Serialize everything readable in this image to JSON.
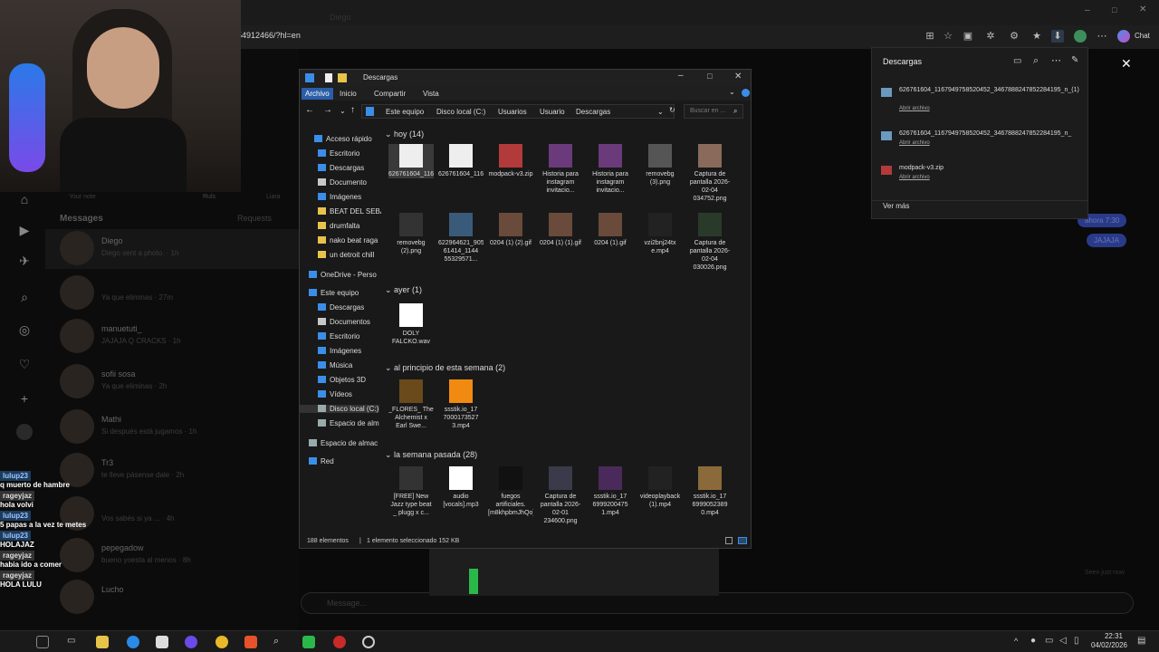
{
  "browser": {
    "url": "54912466/?hl=en",
    "chat_label": "Chat"
  },
  "instagram": {
    "nav_icons": [
      "home-icon",
      "search-icon",
      "explore-icon",
      "reels-icon",
      "messages-icon",
      "notifications-icon",
      "create-icon",
      "profile-icon"
    ],
    "top_labels": [
      "Your note",
      "Ruls",
      "Liara"
    ],
    "messages_label": "Messages",
    "requests_label": "Requests",
    "conversations": [
      {
        "name": "Diego",
        "preview": "Diego sent a photo. · 1h"
      },
      {
        "name": "",
        "preview": "Ya que eliminas · 27m"
      },
      {
        "name": "manuetuti_",
        "preview": "JAJAJA Q CRACKS · 1h"
      },
      {
        "name": "sofii sosa",
        "preview": "Ya que eliminas · 2h"
      },
      {
        "name": "Mathi",
        "preview": "Si después está jugamos · 1h"
      },
      {
        "name": "Tr3",
        "preview": "te lleve pásense dale · 2h"
      },
      {
        "name": "",
        "preview": "Vos sabés si ya ... · 4h"
      },
      {
        "name": "pepegadow",
        "preview": "bueno yoesta al menos · 8h"
      },
      {
        "name": "Lucho",
        "preview": ""
      }
    ],
    "thread_header": "Diego",
    "bubble_1": "ahora 7:30",
    "bubble_2": "JAJAJA",
    "seen": "Seen just now",
    "message_placeholder": "Message..."
  },
  "chat": [
    {
      "user": "lulup23",
      "msg": "q muerto de hambre"
    },
    {
      "user": "rageyjaz",
      "msg": "hola volvi"
    },
    {
      "user": "lulup23",
      "msg": "5 papas a la vez te metes"
    },
    {
      "user": "lulup23",
      "msg": "HOLAJAZ"
    },
    {
      "user": "rageyjaz",
      "msg": "habia ido a comer"
    },
    {
      "user": "rageyjaz",
      "msg": "HOLA LULU"
    }
  ],
  "explorer": {
    "title": "Descargas",
    "ribbon": [
      "Archivo",
      "Inicio",
      "Compartir",
      "Vista"
    ],
    "path": [
      "Este equipo",
      "Disco local (C:)",
      "Usuarios",
      "Usuario",
      "Descargas"
    ],
    "search_placeholder": "Buscar en ...",
    "nav": [
      {
        "label": "Acceso rápido",
        "color": "#3b8ee8"
      },
      {
        "label": "Escritorio",
        "color": "#3b8ee8"
      },
      {
        "label": "Descargas",
        "color": "#3b8ee8"
      },
      {
        "label": "Documento",
        "color": "#c7c7c7"
      },
      {
        "label": "Imágenes",
        "color": "#3b8ee8"
      },
      {
        "label": "BEAT DEL SEBA",
        "color": "#e8c34a"
      },
      {
        "label": "drumfalta",
        "color": "#e8c34a"
      },
      {
        "label": "nako beat raga",
        "color": "#e8c34a"
      },
      {
        "label": "un detroit chill",
        "color": "#e8c34a"
      },
      {
        "label": "OneDrive - Perso",
        "color": "#3b8ee8"
      },
      {
        "label": "Este equipo",
        "color": "#3b8ee8"
      },
      {
        "label": "Descargas",
        "color": "#3b8ee8"
      },
      {
        "label": "Documentos",
        "color": "#c7c7c7"
      },
      {
        "label": "Escritorio",
        "color": "#3b8ee8"
      },
      {
        "label": "Imágenes",
        "color": "#3b8ee8"
      },
      {
        "label": "Música",
        "color": "#3b8ee8"
      },
      {
        "label": "Objetos 3D",
        "color": "#3b8ee8"
      },
      {
        "label": "Vídeos",
        "color": "#3b8ee8"
      },
      {
        "label": "Disco local (C:)",
        "color": "#9aa"
      },
      {
        "label": "Espacio de alm",
        "color": "#9aa"
      },
      {
        "label": "Espacio de almac",
        "color": "#9aa"
      },
      {
        "label": "Red",
        "color": "#3b8ee8"
      }
    ],
    "groups": [
      {
        "label": "hoy (14)",
        "files": [
          {
            "name": "626761604_1167949758520452_3467888247...",
            "color": "#eeeeee"
          },
          {
            "name": "626761604_1167949758520452_3467888247...",
            "color": "#eeeeee"
          },
          {
            "name": "modpack-v3.zip",
            "color": "#b33a3a"
          },
          {
            "name": "Historia para instagram invitacio...",
            "color": "#6a3a7a"
          },
          {
            "name": "Historia para instagram invitacio...",
            "color": "#6a3a7a"
          },
          {
            "name": "removebg (3).png",
            "color": "#555555"
          },
          {
            "name": "Captura de pantalla 2026-02-04 034752.png",
            "color": "#8a6a5a"
          },
          {
            "name": "removebg (2).png",
            "color": "#333333"
          },
          {
            "name": "622964621_9054299357 61414_1144 55329571...",
            "color": "#3a5a7a"
          },
          {
            "name": "0204 (1) (2).gif",
            "color": "#6a4a3a"
          },
          {
            "name": "0204 (1) (1).gif",
            "color": "#6a4a3a"
          },
          {
            "name": "0204 (1).gif",
            "color": "#6a4a3a"
          },
          {
            "name": "vzi2bnj24tx e.mp4",
            "color": "#222222"
          },
          {
            "name": "Captura de pantalla 2026-02-04 030026.png",
            "color": "#2a3a2a"
          }
        ]
      },
      {
        "label": "ayer (1)",
        "files": [
          {
            "name": "DOLY FALCKO.wav",
            "color": "#ffffff"
          }
        ]
      },
      {
        "label": "al principio de esta semana (2)",
        "files": [
          {
            "name": "_FLORES_ The Alchemist x Earl Swe...",
            "color": "#6a4a1a"
          },
          {
            "name": "ssstik.io_17 7000173527 3.mp4",
            "color": "#f08a10"
          }
        ]
      },
      {
        "label": "la semana pasada (28)",
        "files": [
          {
            "name": "[FREE] New Jazz type beat _ plugg x c...",
            "color": "#333333"
          },
          {
            "name": "audio [vocals].mp3",
            "color": "#ffffff"
          },
          {
            "name": "fuegos artificiales.[m8khpbmJhQo].mp3",
            "color": "#111111"
          },
          {
            "name": "Captura de pantalla 2026-02-01 234600.png",
            "color": "#3a3a4a"
          },
          {
            "name": "ssstik.io_17 6999200475 1.mp4",
            "color": "#4a2a5a"
          },
          {
            "name": "videoplayback (1).mp4",
            "color": "#222222"
          },
          {
            "name": "ssstik.io_17 6999052389 0.mp4",
            "color": "#8a6a3a"
          }
        ]
      }
    ],
    "status_count": "188 elementos",
    "status_selected": "1 elemento seleccionado  152 KB"
  },
  "downloads": {
    "title": "Descargas",
    "items": [
      {
        "name": "626761604_1167949758520452_3467888247852284195_n_(1)",
        "action": "Abrir archivo"
      },
      {
        "name": "626761604_1167949758520452_3467888247852284195_n_",
        "action": "Abrir archivo"
      },
      {
        "name": "modpack-v3.zip",
        "action": "Abrir archivo"
      }
    ],
    "more": "Ver más"
  },
  "taskbar": {
    "time": "22:31",
    "date": "04/02/2026"
  }
}
